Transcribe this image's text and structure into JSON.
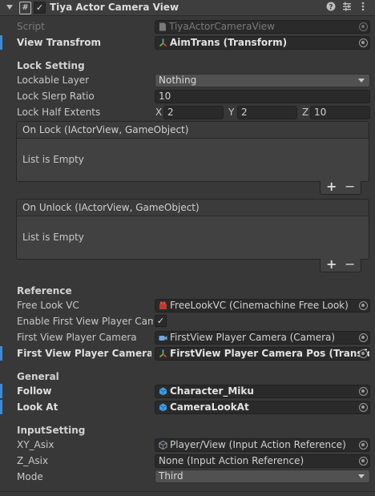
{
  "header": {
    "title": "Tiya Actor Camera View",
    "enabled": true,
    "icons": [
      "help-icon",
      "preset-icon",
      "more-icon"
    ]
  },
  "script": {
    "label": "Script",
    "value": "TiyaActorCameraView"
  },
  "view_transform": {
    "label": "View Transfrom",
    "value": "AimTrans (Transform)"
  },
  "lock_setting": {
    "title": "Lock Setting",
    "lockable_layer": {
      "label": "Lockable Layer",
      "value": "Nothing"
    },
    "slerp_ratio": {
      "label": "Lock Slerp Ratio",
      "value": "10"
    },
    "half_extents": {
      "label": "Lock Half Extents",
      "x_label": "X",
      "x": "2",
      "y_label": "Y",
      "y": "2",
      "z_label": "Z",
      "z": "10"
    },
    "on_lock": {
      "header": "On Lock (IActorView, GameObject)",
      "empty_text": "List is Empty",
      "add": "+",
      "remove": "−"
    },
    "on_unlock": {
      "header": "On Unlock (IActorView, GameObject)",
      "empty_text": "List is Empty",
      "add": "+",
      "remove": "−"
    }
  },
  "reference": {
    "title": "Reference",
    "free_look_vc": {
      "label": "Free Look VC",
      "value": "FreeLookVC (Cinemachine Free Look)"
    },
    "enable_first_view": {
      "label": "Enable First View Player Camera",
      "checked": true
    },
    "first_view_camera": {
      "label": "First View Player Camera",
      "value": "FirstView Player Camera (Camera)"
    },
    "first_view_follow": {
      "label": "First View Player Camera Follow",
      "value": "FirstView Player Camera Pos (Transform)"
    }
  },
  "general": {
    "title": "General",
    "follow": {
      "label": "Follow",
      "value": "Character_Miku"
    },
    "look_at": {
      "label": "Look At",
      "value": "CameraLookAt"
    }
  },
  "input_setting": {
    "title": "InputSetting",
    "xy_asix": {
      "label": "XY_Asix",
      "value": "Player/View (Input Action Reference)"
    },
    "z_asix": {
      "label": "Z_Asix",
      "value": "None (Input Action Reference)"
    },
    "mode": {
      "label": "Mode",
      "value": "Third"
    }
  },
  "colors": {
    "accent": "#3d8bd6",
    "background": "#383838",
    "field": "#2a2a2a",
    "popup": "#515151"
  }
}
